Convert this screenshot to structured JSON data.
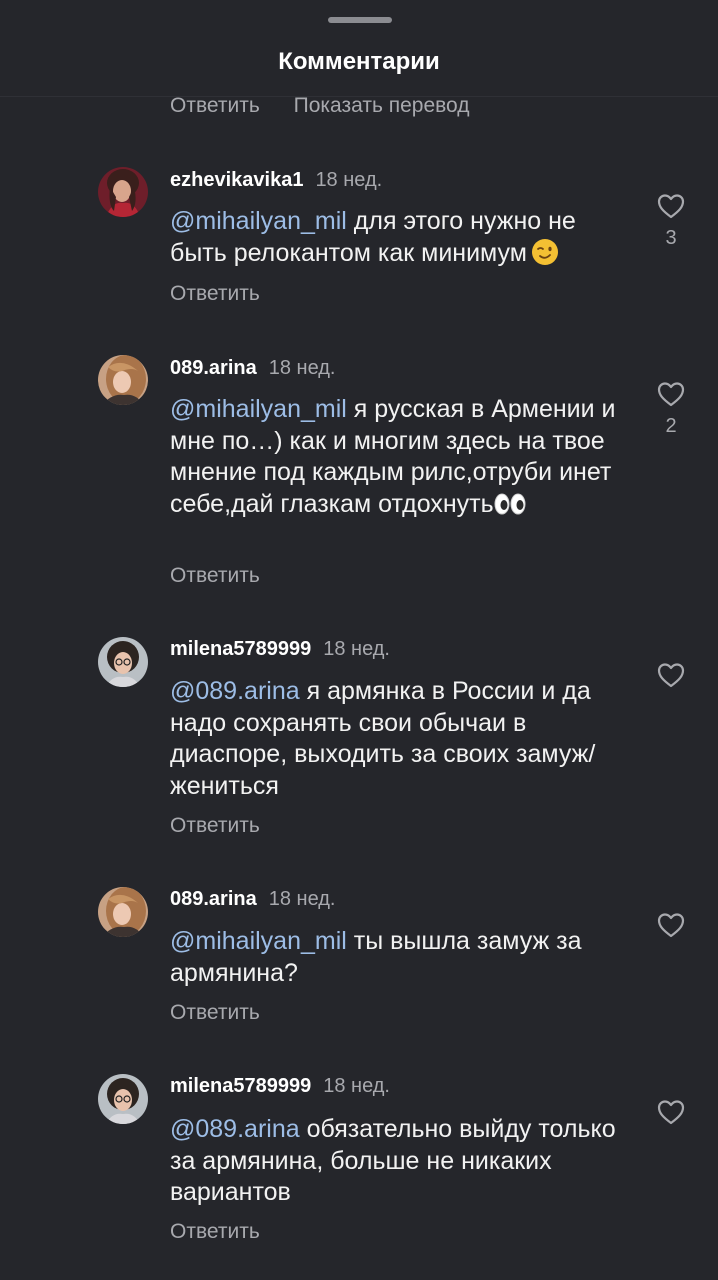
{
  "sheet": {
    "title": "Комментарии",
    "top_actions": {
      "reply": "Ответить",
      "translate": "Показать перевод"
    }
  },
  "comments": [
    {
      "username": "ezhevikavika1",
      "time": "18 нед.",
      "mention": "@mihailyan_mil",
      "text": " для этого нужно не быть релокантом как минимум",
      "emoji": "winking-face",
      "reply_label": "Ответить",
      "likes": "3"
    },
    {
      "username": "089.arina",
      "time": "18 нед.",
      "mention": "@mihailyan_mil",
      "text": " я русская в Армении и мне по…) как и многим здесь на твое мнение под каждым рилс,отруби инет себе,дай глазкам отдохнуть",
      "emoji": "eyes",
      "reply_label": "Ответить",
      "likes": "2"
    },
    {
      "username": "milena5789999",
      "time": "18 нед.",
      "mention": "@089.arina",
      "text": " я армянка в России и да надо сохранять свои обычаи в диаспоре, выходить за своих замуж/жениться",
      "reply_label": "Ответить",
      "likes": ""
    },
    {
      "username": "089.arina",
      "time": "18 нед.",
      "mention": "@mihailyan_mil",
      "text": " ты вышла замуж за армянина?",
      "reply_label": "Ответить",
      "likes": ""
    },
    {
      "username": "milena5789999",
      "time": "18 нед.",
      "mention": "@089.arina",
      "text": " обязательно выйду только за армянина, больше не никаких вариантов",
      "reply_label": "Ответить",
      "likes": ""
    }
  ],
  "colors": {
    "background": "#25262b",
    "mention": "#9dbde6",
    "secondary_text": "#a8a9ae"
  },
  "icons": {
    "like": "heart-outline-icon"
  }
}
